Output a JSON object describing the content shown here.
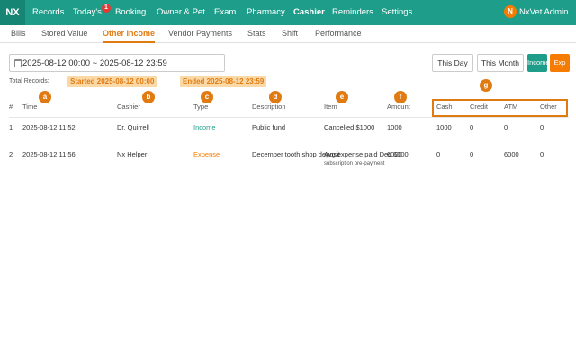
{
  "app": {
    "logo": "NX",
    "nav": [
      "Records",
      "Today's",
      "Booking",
      "Owner & Pet",
      "Exam",
      "Pharmacy",
      "Cashier",
      "Reminders",
      "Settings"
    ],
    "active_nav": "Cashier",
    "todays_badge": "1",
    "user_initial": "N",
    "user_name": "NxVet Admin"
  },
  "subnav": {
    "tabs": [
      "Bills",
      "Stored Value",
      "Other Income",
      "Vendor Payments",
      "Stats",
      "Shift",
      "Performance"
    ],
    "active": "Other Income"
  },
  "filter": {
    "date_range": "2025-08-12 00:00 ~ 2025-08-12 23:59",
    "this_day": "This Day",
    "this_month": "This Month",
    "income_button": "Income",
    "expense_button": "Exp"
  },
  "summary": {
    "total_records_label": "Total Records:",
    "started": "Started 2025-08-12 00:00",
    "ended": "Ended 2025-08-12 23:59"
  },
  "markers": [
    "a",
    "b",
    "c",
    "d",
    "e",
    "f",
    "g"
  ],
  "table": {
    "columns": [
      "#",
      "Time",
      "Cashier",
      "Type",
      "Description",
      "Item",
      "Amount",
      "Cash",
      "Credit",
      "ATM",
      "Other"
    ],
    "rows": [
      {
        "no": "1",
        "time": "2025-08-12 11:52",
        "cashier": "Dr. Quirrell",
        "type": "Income",
        "description": "Public fund",
        "item": "Cancelled $1000",
        "item_sub": "",
        "amount": "1000",
        "cash": "1000",
        "credit": "0",
        "atm": "0",
        "other": "0"
      },
      {
        "no": "2",
        "time": "2025-08-12 11:56",
        "cashier": "Nx Helper",
        "type": "Expense",
        "description": "December tooth shop deposit",
        "item": "Avg expense paid Dec 6000",
        "item_sub": "subscription pre-payment",
        "amount": "6000",
        "cash": "0",
        "credit": "0",
        "atm": "6000",
        "other": "0"
      }
    ]
  },
  "colors": {
    "primary": "#1e9e8a",
    "accent": "#e07b12",
    "expense": "#f57c00",
    "chip_bg": "#fbd9a6"
  }
}
